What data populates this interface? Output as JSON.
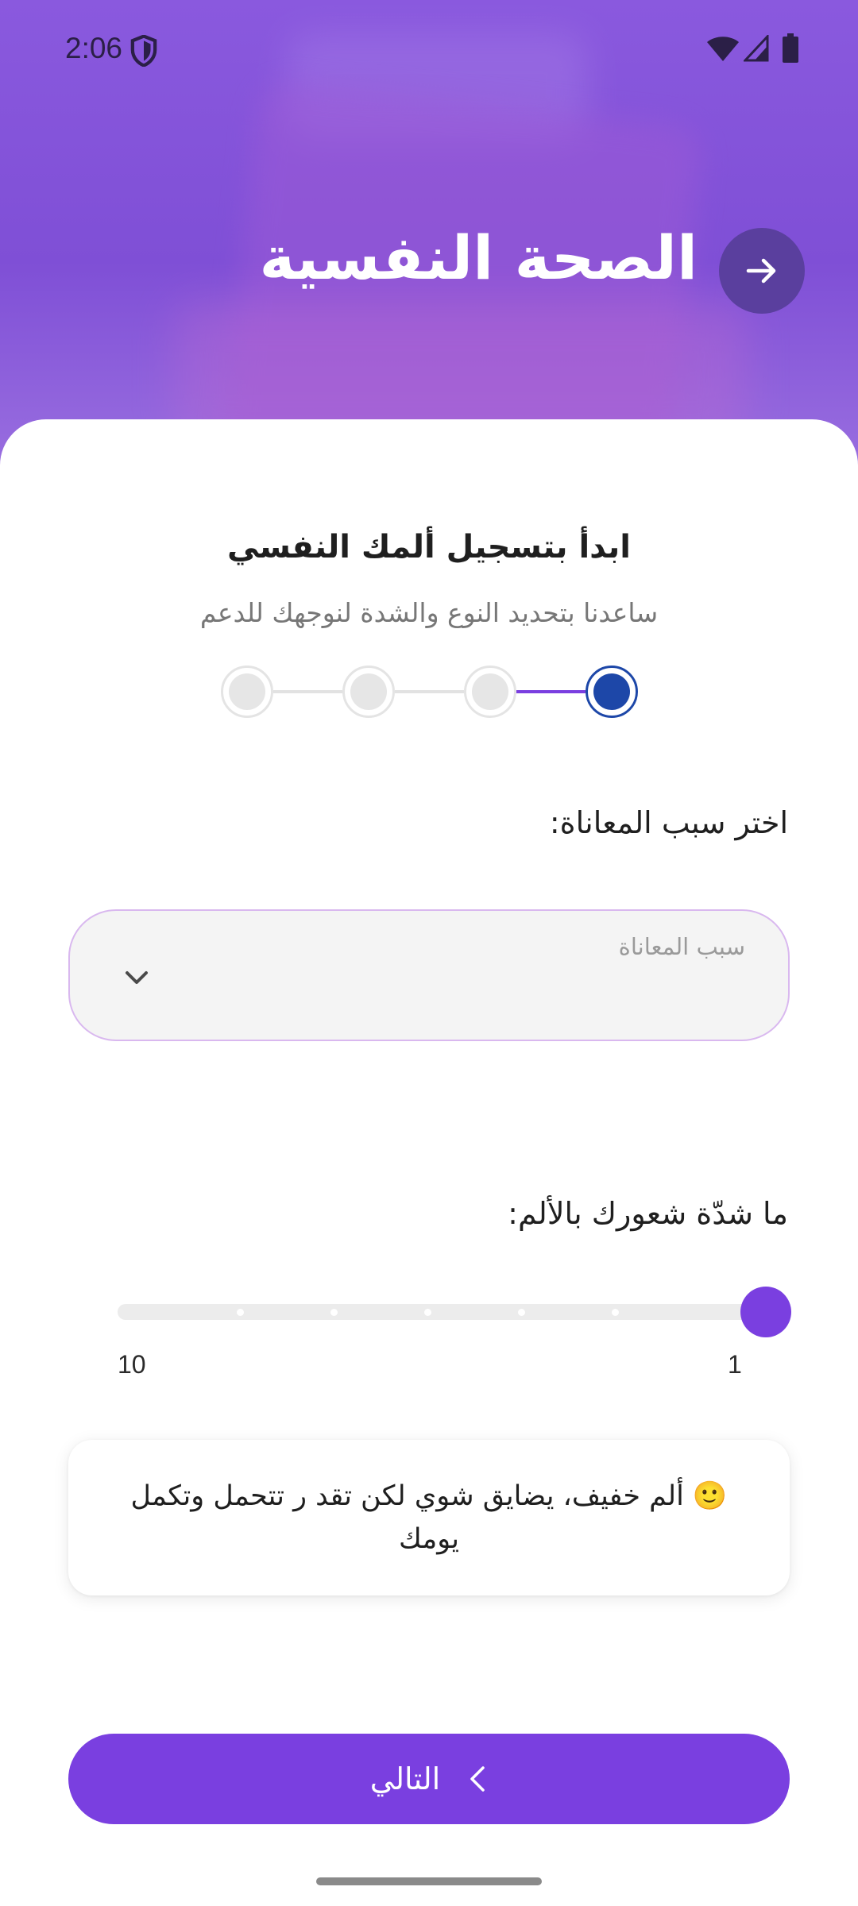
{
  "status_bar": {
    "time": "2:06"
  },
  "header": {
    "title": "الصحة النفسية"
  },
  "intro": {
    "title": "ابدأ بتسجيل ألمك النفسي",
    "subtitle": "ساعدنا بتحديد النوع والشدة لنوجهك للدعم"
  },
  "stepper": {
    "total_steps": 4,
    "current_step": 1
  },
  "reason": {
    "label": "اختر سبب المعاناة:",
    "placeholder": "سبب المعاناة"
  },
  "intensity": {
    "label": "ما شدّة شعورك بالألم:",
    "min_label": "1",
    "max_label": "10",
    "value": 1
  },
  "feedback": {
    "text": "🙂 ألم خفيف، يضايق شوي لكن تقد ر تتحمل وتكمل يومك"
  },
  "next_button": {
    "label": "التالي"
  },
  "colors": {
    "primary": "#7a3fe0",
    "step_active": "#1d47a8",
    "header": "#8a59de"
  }
}
